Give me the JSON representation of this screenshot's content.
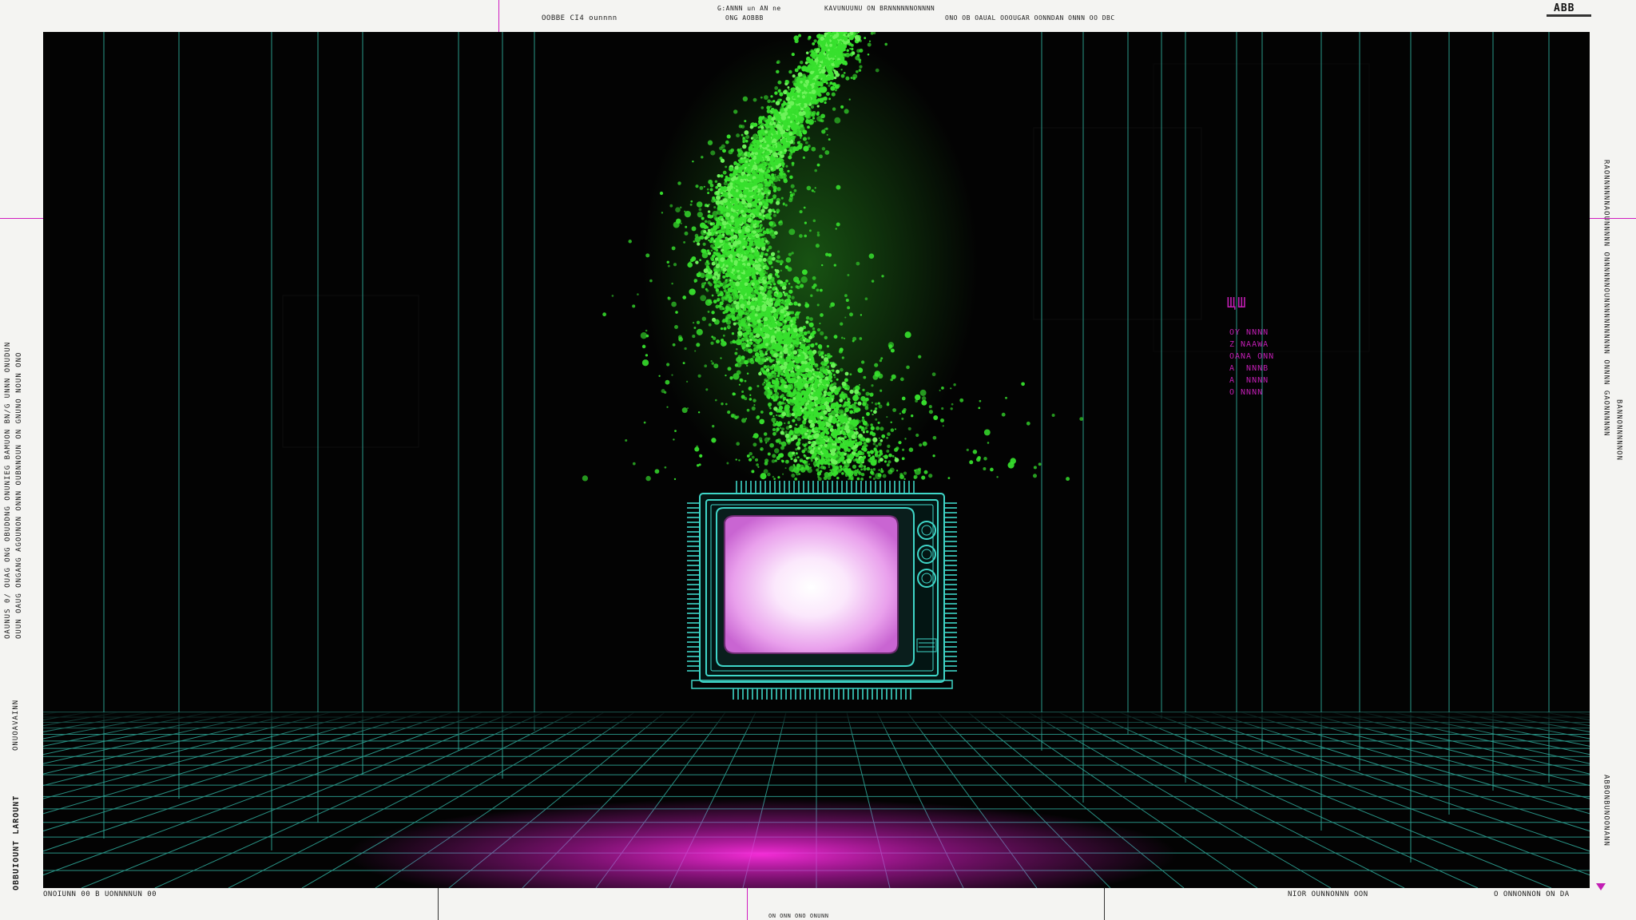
{
  "header": {
    "left_label": "OOBBE CI4 ounnnn",
    "center_label_1": "G:ANNN  un  AN  ne",
    "center_label_2": "ONG  AOBBB",
    "center_label_3": "KAVUNUUNU ON BRNNNNNNONNNN",
    "right_label": "ONO OB  OAUAL  OOOUGAR OONNDAN ONNN OO DBC",
    "logo": "ABB"
  },
  "left_margin": {
    "col1": "OAUNUS 0/ OUAG ONG OBUDDNG ONUNIEG BAMUON BN/G UNNN ONUDUN",
    "col2": "OUUN OAUG ONGANG AGOUNON ONNN OUBNNOUN  ON GNUNO NOUN ONO",
    "label_mid": "ONUOAVAINN",
    "label_bottom": "OBBUIOUNT LAROUNT"
  },
  "right_margin": {
    "col1": "RAONNNNNNAOUNNNNN ONNNNNNOUNNNNNNNNNNN ONNNN GAONNNNNN",
    "col2": "BANNONNNNNON",
    "col3": "ABBONBUNOONANN"
  },
  "footer": {
    "left_label": "ONOIUNN 00 B UONNNNUN 00",
    "center_label": "ON ONN ONO ONUNN",
    "right_label_1": "NIOR OUNNONNN OON",
    "right_label_2": "O ONNONNON ON DA"
  },
  "scene_label": {
    "title": "ЩШ",
    "lines": [
      "OY NNNN",
      "Z NAAWA",
      "OANA ONN",
      "A  NNNB",
      "A  NNNN",
      "O NNNN"
    ]
  },
  "colors": {
    "background": "#030303",
    "grid": "#2fa99a",
    "tv_outline": "#3fd6c8",
    "screen": "#f2b6f4",
    "glow": "#e81ec8",
    "particles": "#37e02d",
    "paper": "#f4f4f2",
    "hairline": "#d01cc0"
  },
  "icons": {
    "tv": "retro-crt-television-icon",
    "particles": "green-particle-stream",
    "grid_floor": "perspective-grid-floor"
  }
}
